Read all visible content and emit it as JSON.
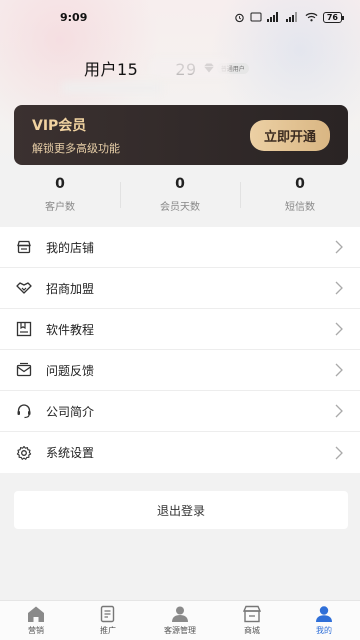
{
  "status_bar": {
    "time": "9:09",
    "battery": "76"
  },
  "profile": {
    "username": "用户15          29",
    "badge_label": "普通用户"
  },
  "vip": {
    "title": "VIP会员",
    "subtitle": "解锁更多高级功能",
    "button_label": "立即开通"
  },
  "stats": [
    {
      "value": "0",
      "label": "客户数"
    },
    {
      "value": "0",
      "label": "会员天数"
    },
    {
      "value": "0",
      "label": "短信数"
    }
  ],
  "menu": [
    {
      "label": "我的店铺",
      "icon": "store-icon"
    },
    {
      "label": "招商加盟",
      "icon": "handshake-icon"
    },
    {
      "label": "软件教程",
      "icon": "tutorial-icon"
    },
    {
      "label": "问题反馈",
      "icon": "feedback-icon"
    },
    {
      "label": "公司简介",
      "icon": "headset-icon"
    },
    {
      "label": "系统设置",
      "icon": "gear-icon"
    }
  ],
  "logout_label": "退出登录",
  "tabbar": [
    {
      "label": "营销",
      "icon": "home-icon",
      "active": false
    },
    {
      "label": "推广",
      "icon": "document-icon",
      "active": false
    },
    {
      "label": "客源管理",
      "icon": "contacts-icon",
      "active": false
    },
    {
      "label": "商城",
      "icon": "shop-icon",
      "active": false
    },
    {
      "label": "我的",
      "icon": "user-icon",
      "active": true
    }
  ],
  "colors": {
    "accent": "#2f6fd8",
    "vip_bg": "#2f2827",
    "vip_gold": "#e8cfa8"
  }
}
